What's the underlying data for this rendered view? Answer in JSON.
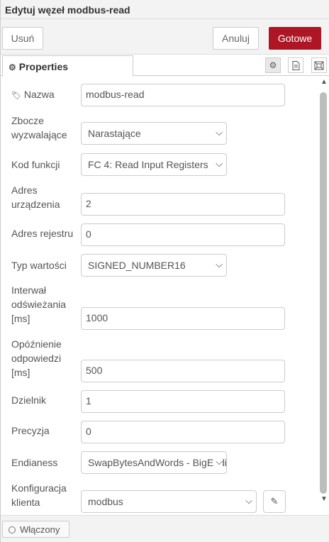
{
  "window": {
    "title": "Edytuj węzeł modbus-read"
  },
  "toolbar": {
    "delete_label": "Usuń",
    "cancel_label": "Anuluj",
    "done_label": "Gotowe"
  },
  "tabs": {
    "properties_label": "Properties"
  },
  "form": {
    "name": {
      "label": "Nazwa",
      "value": "modbus-read"
    },
    "trigger": {
      "label_line1": "Zbocze",
      "label_line2": "wyzwalające",
      "value": "Narastające"
    },
    "function_code": {
      "label": "Kod funkcji",
      "value": "FC 4: Read Input Registers"
    },
    "device_address": {
      "label_line1": "Adres",
      "label_line2": "urządzenia",
      "value": "2"
    },
    "register_address": {
      "label": "Adres rejestru",
      "value": "0"
    },
    "value_type": {
      "label": "Typ wartości",
      "value": "SIGNED_NUMBER16"
    },
    "refresh_interval": {
      "label_line1": "Interwał",
      "label_line2": "odświeżania",
      "label_line3": "[ms]",
      "value": "1000"
    },
    "response_delay": {
      "label_line1": "Opóźnienie",
      "label_line2": "odpowiedzi",
      "label_line3": "[ms]",
      "value": "500"
    },
    "divider": {
      "label": "Dzielnik",
      "value": "1"
    },
    "precision": {
      "label": "Precyzja",
      "value": "0"
    },
    "endianess": {
      "label": "Endianess",
      "value": "SwapBytesAndWords - BigEndian"
    },
    "client_config": {
      "label_line1": "Konfiguracja",
      "label_line2": "klienta",
      "value": "modbus"
    }
  },
  "footer": {
    "enabled_label": "Włączony"
  },
  "colors": {
    "primary": "#ad1625",
    "panel_bg": "#f3f3f3",
    "border": "#cccccc"
  }
}
